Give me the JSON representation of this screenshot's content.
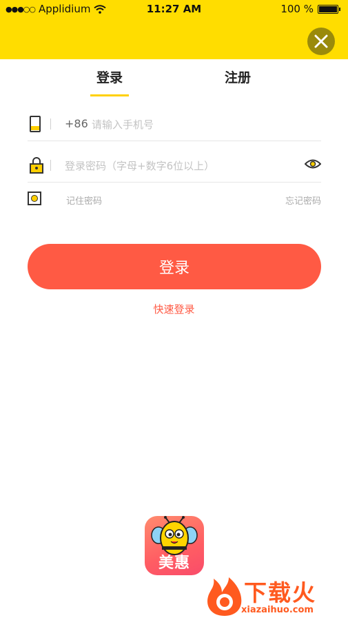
{
  "status_bar": {
    "carrier": "Applidium",
    "signal_dots": "●●●○○",
    "time": "11:27 AM",
    "battery": "100 %"
  },
  "colors": {
    "header_yellow": "#ffdd00",
    "accent_red": "#ff5a44",
    "tab_underline": "#ffd000"
  },
  "tabs": {
    "login": "登录",
    "register": "注册"
  },
  "phone": {
    "prefix": "+86",
    "placeholder": "请输入手机号",
    "value": ""
  },
  "password": {
    "placeholder": "登录密码（字母+数字6位以上）",
    "value": ""
  },
  "remember": {
    "label": "记住密码",
    "forgot": "忘记密码"
  },
  "login_button": "登录",
  "quick_login": "快速登录",
  "app_logo": {
    "text": "美惠"
  },
  "watermark": {
    "text": "下载火",
    "url": "xiazaihuo.com"
  }
}
